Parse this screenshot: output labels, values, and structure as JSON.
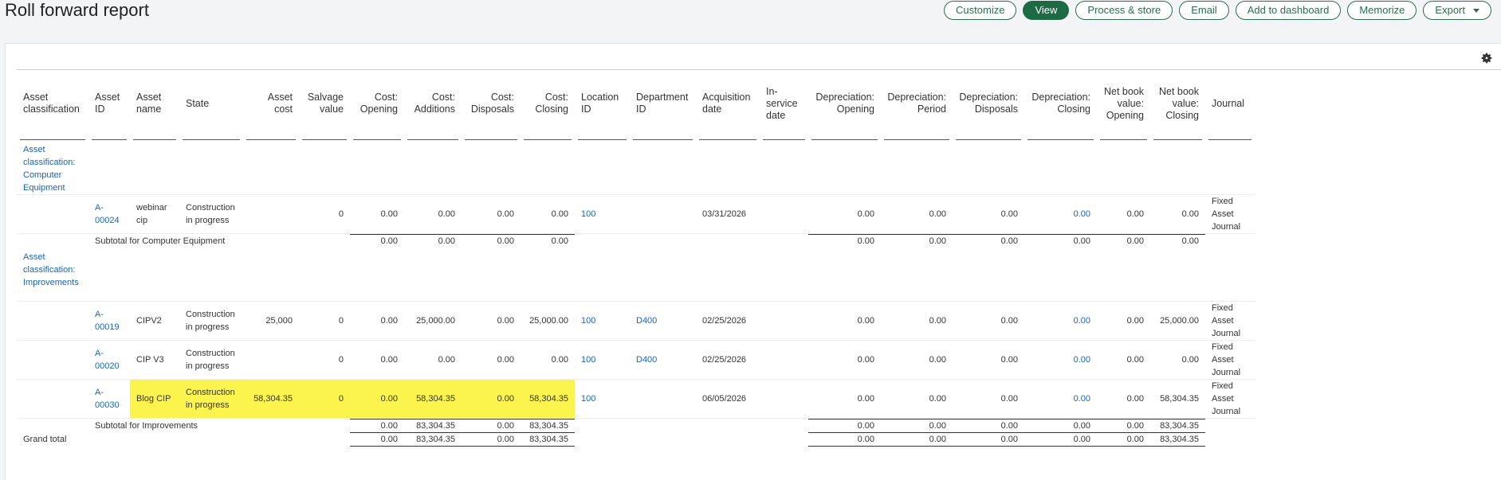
{
  "page": {
    "title": "Roll forward report"
  },
  "toolbar": {
    "customize": "Customize",
    "view": "View",
    "process_store": "Process & store",
    "email": "Email",
    "add_dashboard": "Add to dashboard",
    "memorize": "Memorize",
    "export": "Export"
  },
  "colors": {
    "accent": "#1d6b45",
    "link": "#1565c0",
    "highlight": "#fbf44c"
  },
  "columns": {
    "asset_classification": "Asset classification",
    "asset_id": "Asset ID",
    "asset_name": "Asset name",
    "state": "State",
    "asset_cost": "Asset cost",
    "salvage_value": "Salvage value",
    "cost_opening": "Cost: Opening",
    "cost_additions": "Cost: Additions",
    "cost_disposals": "Cost: Disposals",
    "cost_closing": "Cost: Closing",
    "location_id": "Location ID",
    "department_id": "Department ID",
    "acquisition_date": "Acquisition date",
    "in_service_date": "In-service date",
    "dep_opening": "Depreciation: Opening",
    "dep_period": "Depreciation: Period",
    "dep_disposals": "Depreciation: Disposals",
    "dep_closing": "Depreciation: Closing",
    "nbv_opening": "Net book value: Opening",
    "nbv_closing": "Net book value: Closing",
    "journal": "Journal"
  },
  "groups": {
    "computer": {
      "label": "Asset classification: Computer Equipment",
      "row1": {
        "asset_id": "A-00024",
        "asset_name": "webinar cip",
        "state": "Construction in progress",
        "asset_cost": "",
        "salvage": "0",
        "cost_opening": "0.00",
        "cost_additions": "0.00",
        "cost_disposals": "0.00",
        "cost_closing": "0.00",
        "location": "100",
        "department": "",
        "acq_date": "03/31/2026",
        "inservice": "",
        "dep_opening": "0.00",
        "dep_period": "0.00",
        "dep_disposals": "0.00",
        "dep_closing": "0.00",
        "nbv_opening": "0.00",
        "nbv_closing": "0.00",
        "journal": "Fixed Asset Journal"
      },
      "subtotal": {
        "label": "Subtotal for Computer Equipment",
        "cost_opening": "0.00",
        "cost_additions": "0.00",
        "cost_disposals": "0.00",
        "cost_closing": "0.00",
        "dep_opening": "0.00",
        "dep_period": "0.00",
        "dep_disposals": "0.00",
        "dep_closing": "0.00",
        "nbv_opening": "0.00",
        "nbv_closing": "0.00"
      }
    },
    "improvements": {
      "label": "Asset classification: Improvements",
      "row1": {
        "asset_id": "A-00019",
        "asset_name": "CIPV2",
        "state": "Construction in progress",
        "asset_cost": "25,000",
        "salvage": "0",
        "cost_opening": "0.00",
        "cost_additions": "25,000.00",
        "cost_disposals": "0.00",
        "cost_closing": "25,000.00",
        "location": "100",
        "department": "D400",
        "acq_date": "02/25/2026",
        "inservice": "",
        "dep_opening": "0.00",
        "dep_period": "0.00",
        "dep_disposals": "0.00",
        "dep_closing": "0.00",
        "nbv_opening": "0.00",
        "nbv_closing": "25,000.00",
        "journal": "Fixed Asset Journal"
      },
      "row2": {
        "asset_id": "A-00020",
        "asset_name": "CIP V3",
        "state": "Construction in progress",
        "asset_cost": "",
        "salvage": "0",
        "cost_opening": "0.00",
        "cost_additions": "0.00",
        "cost_disposals": "0.00",
        "cost_closing": "0.00",
        "location": "100",
        "department": "D400",
        "acq_date": "02/25/2026",
        "inservice": "",
        "dep_opening": "0.00",
        "dep_period": "0.00",
        "dep_disposals": "0.00",
        "dep_closing": "0.00",
        "nbv_opening": "0.00",
        "nbv_closing": "0.00",
        "journal": "Fixed Asset Journal"
      },
      "row3": {
        "asset_id": "A-00030",
        "asset_name": "Blog CIP",
        "state": "Construction in progress",
        "asset_cost": "58,304.35",
        "salvage": "0",
        "cost_opening": "0.00",
        "cost_additions": "58,304.35",
        "cost_disposals": "0.00",
        "cost_closing": "58,304.35",
        "location": "100",
        "department": "",
        "acq_date": "06/05/2026",
        "inservice": "",
        "dep_opening": "0.00",
        "dep_period": "0.00",
        "dep_disposals": "0.00",
        "dep_closing": "0.00",
        "nbv_opening": "0.00",
        "nbv_closing": "58,304.35",
        "journal": "Fixed Asset Journal"
      },
      "subtotal": {
        "label": "Subtotal for Improvements",
        "cost_opening": "0.00",
        "cost_additions": "83,304.35",
        "cost_disposals": "0.00",
        "cost_closing": "83,304.35",
        "dep_opening": "0.00",
        "dep_period": "0.00",
        "dep_disposals": "0.00",
        "dep_closing": "0.00",
        "nbv_opening": "0.00",
        "nbv_closing": "83,304.35"
      }
    }
  },
  "grand_total": {
    "label": "Grand total",
    "cost_opening": "0.00",
    "cost_additions": "83,304.35",
    "cost_disposals": "0.00",
    "cost_closing": "83,304.35",
    "dep_opening": "0.00",
    "dep_period": "0.00",
    "dep_disposals": "0.00",
    "dep_closing": "0.00",
    "nbv_opening": "0.00",
    "nbv_closing": "83,304.35"
  }
}
